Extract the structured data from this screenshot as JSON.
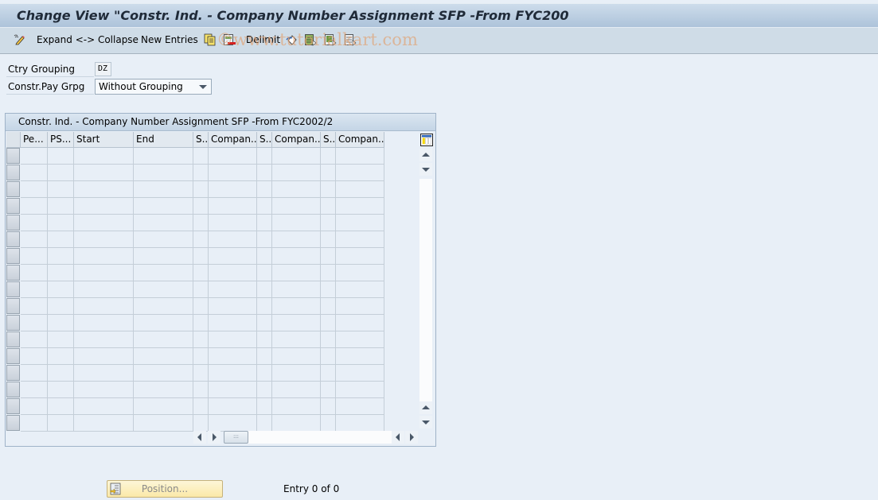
{
  "window": {
    "title": "Change View \"Constr. Ind. - Company Number Assignment SFP -From FYC200"
  },
  "toolbar": {
    "items": [
      {
        "type": "icon",
        "icon": "display-change-icon"
      },
      {
        "type": "button",
        "label": "Expand <-> Collapse"
      },
      {
        "type": "button",
        "label": "New Entries"
      },
      {
        "type": "icon",
        "icon": "copy-as-icon"
      },
      {
        "type": "icon",
        "icon": "delete-icon"
      },
      {
        "type": "button",
        "label": "Delimit"
      },
      {
        "type": "icon",
        "icon": "undo-change-icon"
      },
      {
        "type": "icon",
        "icon": "select-all-icon"
      },
      {
        "type": "icon",
        "icon": "select-block-icon"
      },
      {
        "type": "icon",
        "icon": "deselect-all-icon"
      }
    ],
    "expand_collapse_label": "Expand <-> Collapse",
    "new_entries_label": "New Entries",
    "delimit_label": "Delimit"
  },
  "watermark": "©www.tutorialkart.com",
  "fields": {
    "ctry_grouping": {
      "label": "Ctry Grouping",
      "value": "DZ"
    },
    "constr_pay_grpg": {
      "label": "Constr.Pay Grpg",
      "value": "Without Grouping"
    }
  },
  "table": {
    "title": "Constr. Ind. - Company Number Assignment SFP -From FYC2002/2",
    "columns": [
      "Pe...",
      "PS...",
      "Start",
      "End",
      "S..",
      "Compan...",
      "S..",
      "Compan...",
      "S..",
      "Compan..."
    ],
    "row_count_visible": 17,
    "rows": []
  },
  "scrollbars": {
    "h_thumb_glyph": ":::"
  },
  "footer": {
    "position_label": "Position...",
    "entry_text": "Entry 0 of 0"
  },
  "colors": {
    "background": "#e8eff7",
    "titlebar": "#adc3da",
    "toolbar": "#cfdce7",
    "position_button": "#fbe9a8"
  }
}
